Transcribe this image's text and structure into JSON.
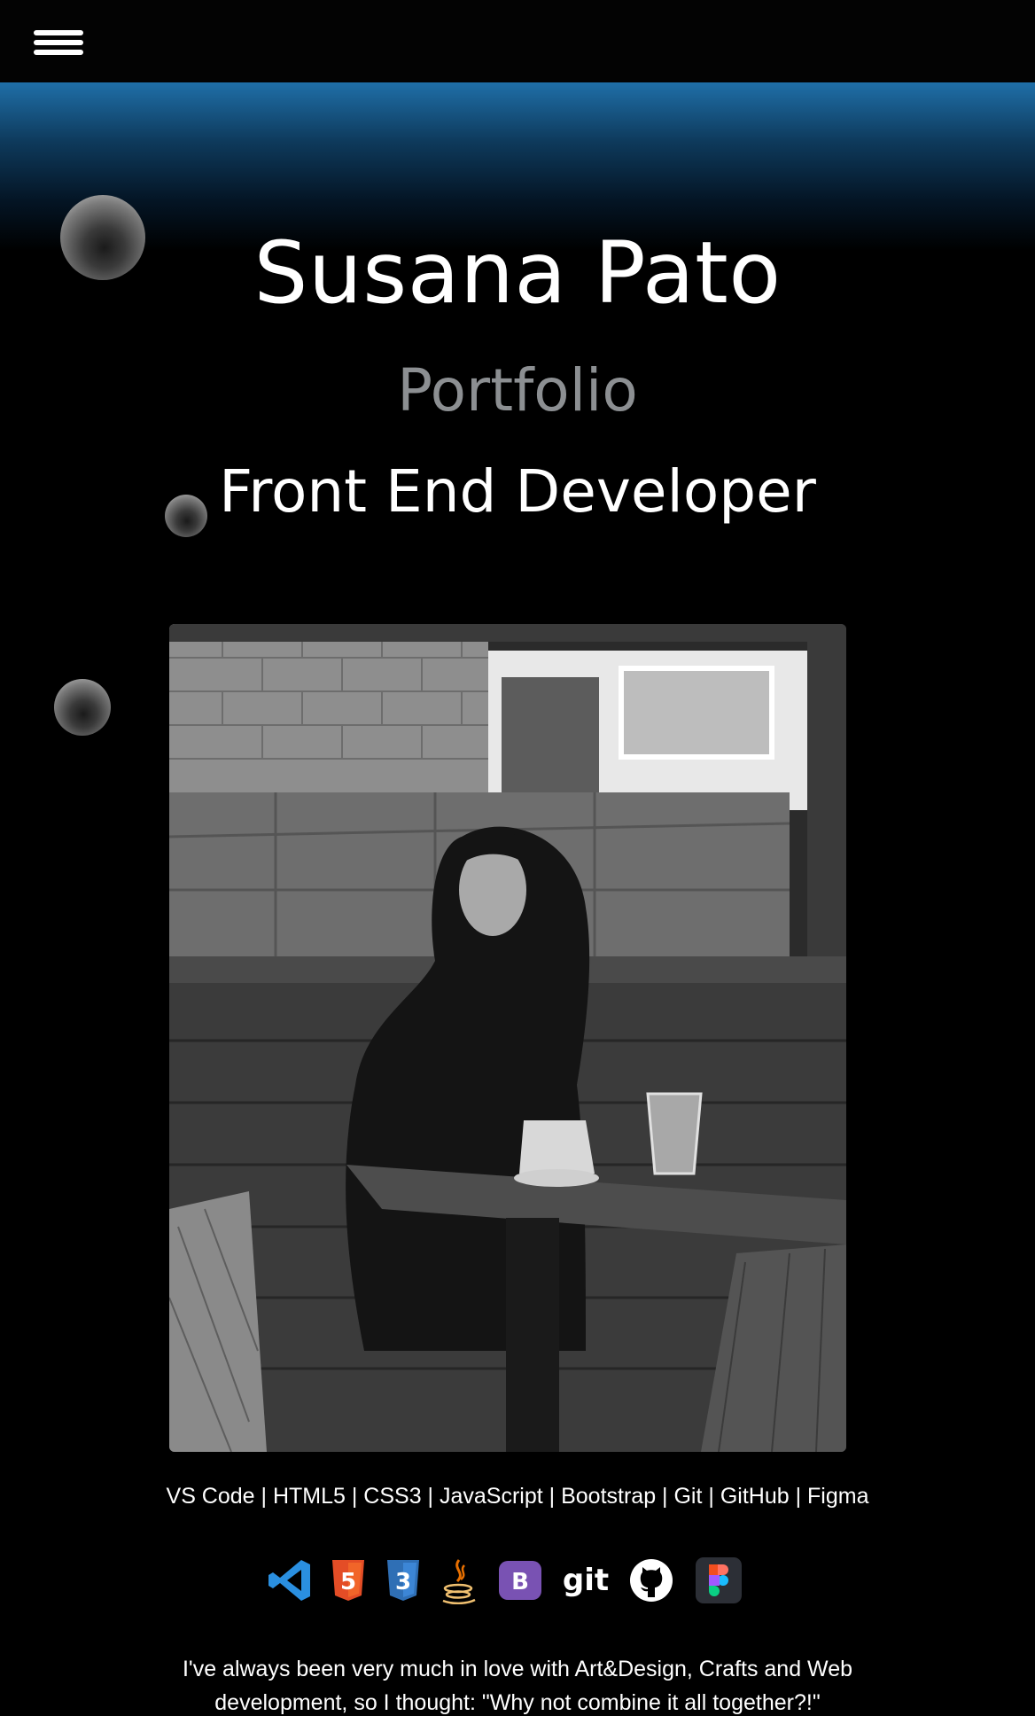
{
  "header": {
    "menu_icon": "hamburger-menu-icon"
  },
  "hero": {
    "name": "Susana Pato",
    "subtitle": "Portfolio",
    "role": "Front End Developer"
  },
  "photo": {
    "description_icon": "profile-photo"
  },
  "skills": {
    "text": "VS Code | HTML5 | CSS3 | JavaScript | Bootstrap | Git | GitHub | Figma",
    "icons": [
      "vscode-icon",
      "html5-icon",
      "css3-icon",
      "java-icon",
      "bootstrap-icon",
      "git-icon",
      "github-icon",
      "figma-icon"
    ],
    "html5_label": "5",
    "css3_label": "3",
    "bootstrap_label": "B",
    "git_label": "git"
  },
  "about": {
    "text": "I've always been very much in love with Art&Design, Crafts and Web development, so I thought: \"Why not combine it all together?!\""
  },
  "colors": {
    "background": "#000000",
    "glow": "#1f6fa8",
    "subtitle": "#8c8f92",
    "vscode": "#2a8fe0",
    "html5": "#e44d26",
    "css3": "#3c86d6",
    "bootstrap": "#7952b3",
    "figma_bg": "#2c2f36"
  }
}
